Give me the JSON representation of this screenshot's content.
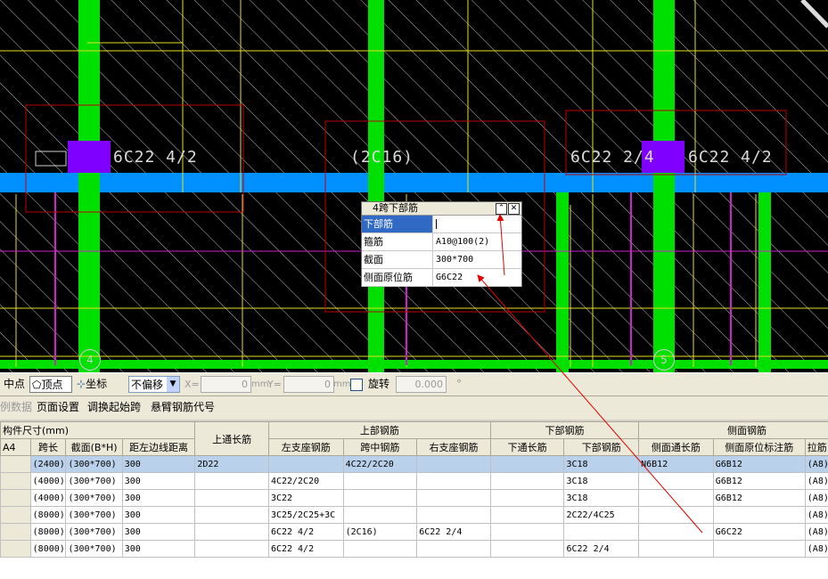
{
  "cad": {
    "labels": [
      "6C22 4/2",
      "(2C16)",
      "6C22 2/4",
      "6C22 4/2"
    ],
    "axis_markers": [
      "4",
      "5"
    ]
  },
  "popup": {
    "title": "4跨下部筋",
    "rows": [
      {
        "key": "下部筋",
        "value": ""
      },
      {
        "key": "箍筋",
        "value": "A10@100(2)"
      },
      {
        "key": "截面",
        "value": "300*700"
      },
      {
        "key": "侧面原位筋",
        "value": "G6C22"
      }
    ]
  },
  "toolbar": {
    "midpoint": "中点",
    "vertex": "顶点",
    "coord": "坐标",
    "offset_select": "不偏移",
    "x_label": "X=",
    "x_value": "0",
    "y_label": "Y=",
    "y_value": "0",
    "unit": "mm",
    "rotate": "旋转",
    "rotate_value": "0.000",
    "deg": "°"
  },
  "menu": {
    "item0": "例数据",
    "item1": "页面设置",
    "item2": "调换起始跨",
    "item3": "悬臂钢筋代号"
  },
  "table": {
    "group_headers": [
      "构件尺寸(mm)",
      "上通长筋",
      "上部钢筋",
      "下部钢筋",
      "侧面钢筋"
    ],
    "sub_headers": [
      "A4",
      "跨长",
      "截面(B*H)",
      "距左边线距离",
      "左支座钢筋",
      "跨中钢筋",
      "右支座钢筋",
      "下通长筋",
      "下部钢筋",
      "侧面通长筋",
      "侧面原位标注筋",
      "拉筋"
    ],
    "rows": [
      [
        "",
        "(2400)",
        "(300*700)",
        "300",
        "2D22",
        "",
        "4C22/2C20",
        "",
        "",
        "3C18",
        "N6B12",
        "G6B12",
        "(A8)"
      ],
      [
        "",
        "(4000)",
        "(300*700)",
        "300",
        "",
        "4C22/2C20",
        "",
        "",
        "",
        "3C18",
        "",
        "G6B12",
        "(A8)"
      ],
      [
        "",
        "(4000)",
        "(300*700)",
        "300",
        "",
        "3C22",
        "",
        "",
        "",
        "3C18",
        "",
        "G6B12",
        "(A8)"
      ],
      [
        "",
        "(8000)",
        "(300*700)",
        "300",
        "",
        "3C25/2C25+3C",
        "",
        "",
        "",
        "2C22/4C25",
        "",
        "",
        "(A8)"
      ],
      [
        "",
        "(8000)",
        "(300*700)",
        "300",
        "",
        "6C22 4/2",
        "(2C16)",
        "6C22 2/4",
        "",
        "",
        "",
        "G6C22",
        "(A8)"
      ],
      [
        "",
        "(8000)",
        "(300*700)",
        "300",
        "",
        "6C22 4/2",
        "",
        "",
        "",
        "6C22 2/4",
        "",
        "",
        "(A8)"
      ]
    ]
  },
  "colors": {
    "column_green": "#00e000",
    "beam_blue": "#0090ff",
    "rebar_yellow": "#e8e020",
    "magenta": "#d020d0",
    "support_purple": "#8000ff",
    "frame_red": "#c00000",
    "selection": "#316ac5"
  }
}
